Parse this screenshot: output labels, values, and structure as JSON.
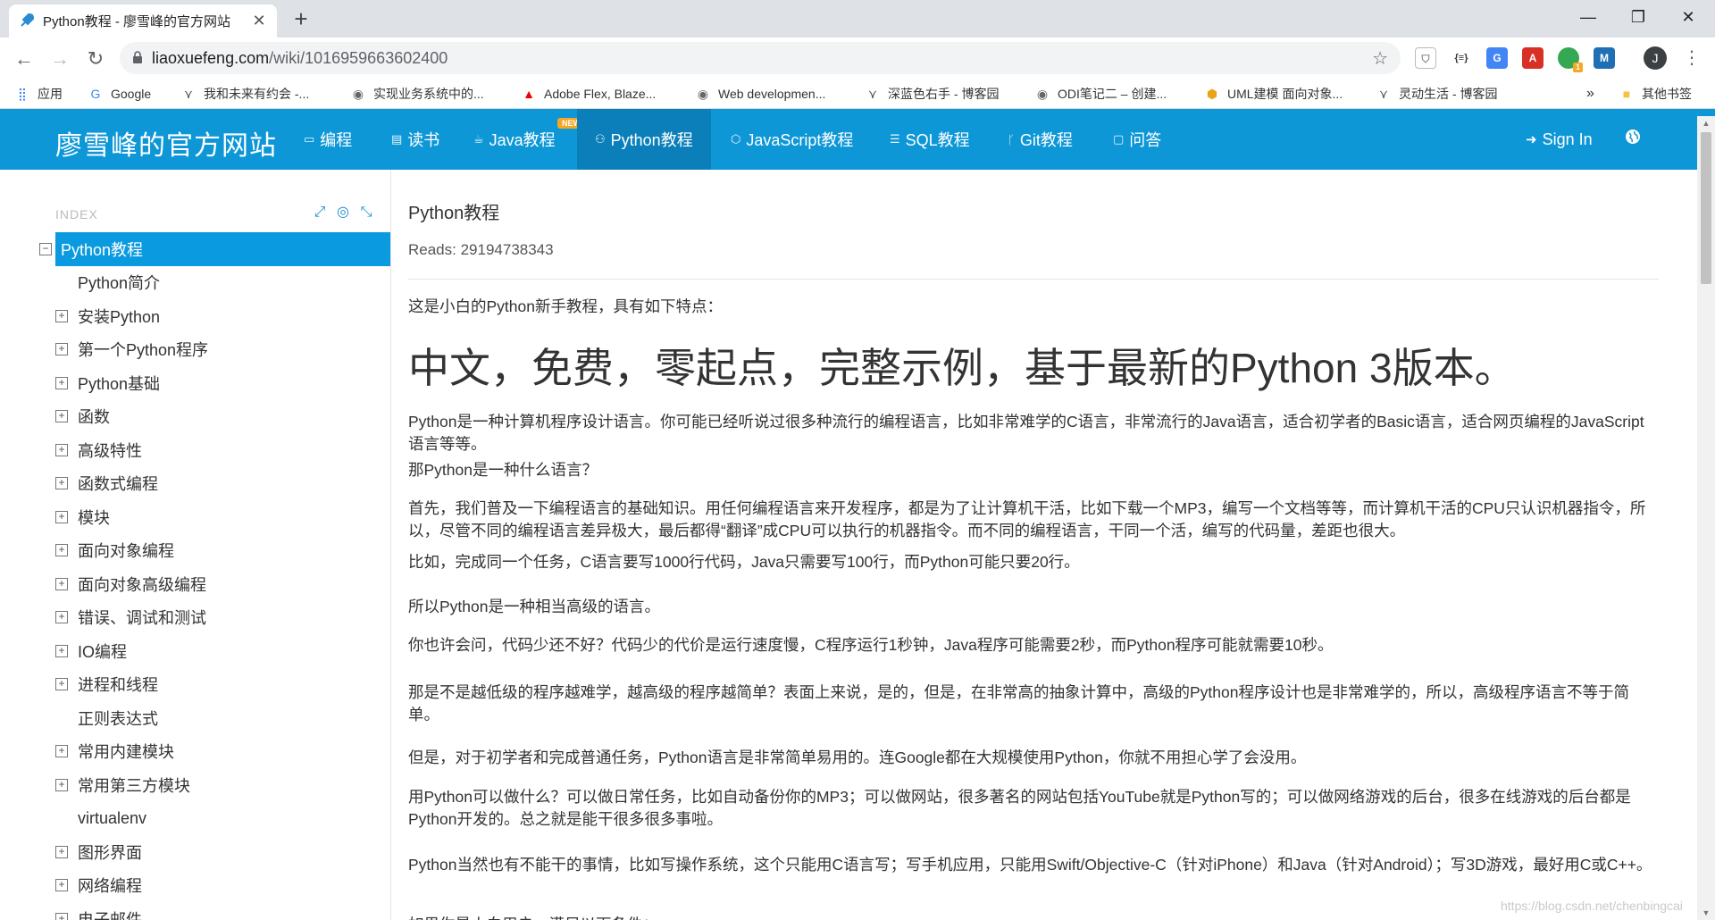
{
  "browser": {
    "tab_title": "Python教程 - 廖雪峰的官方网站",
    "url_host": "liaoxuefeng.com",
    "url_path": "/wiki/1016959663602400",
    "avatar_letter": "J",
    "bookmarks": [
      {
        "label": "应用",
        "icon": "apps-grid-icon"
      },
      {
        "label": "Google",
        "icon": "google-g-icon"
      },
      {
        "label": "我和未来有约会 -...",
        "icon": "cnblogs-icon"
      },
      {
        "label": "实现业务系统中的...",
        "icon": "globe-icon"
      },
      {
        "label": "Adobe Flex, Blaze...",
        "icon": "adobe-icon"
      },
      {
        "label": "Web developmen...",
        "icon": "globe-icon"
      },
      {
        "label": "深蓝色右手 - 博客园",
        "icon": "cnblogs-icon"
      },
      {
        "label": "ODI笔记二 – 创建...",
        "icon": "globe-icon"
      },
      {
        "label": "UML建模 面向对象...",
        "icon": "box-icon"
      },
      {
        "label": "灵动生活 - 博客园",
        "icon": "cnblogs-icon"
      }
    ],
    "bookmarks_overflow": "»",
    "other_bookmarks": "其他书签",
    "ext_badge_count": "1"
  },
  "site": {
    "brand": "廖雪峰的官方网站",
    "nav": [
      {
        "label": "编程",
        "icon": "terminal-icon"
      },
      {
        "label": "读书",
        "icon": "book-icon"
      },
      {
        "label": "Java教程",
        "icon": "coffee-icon"
      },
      {
        "label": "Python教程",
        "icon": "python-icon"
      },
      {
        "label": "JavaScript教程",
        "icon": "html5-icon"
      },
      {
        "label": "SQL教程",
        "icon": "database-icon"
      },
      {
        "label": "Git教程",
        "icon": "git-branch-icon"
      },
      {
        "label": "问答",
        "icon": "chat-icon"
      }
    ],
    "new_badge": "NEW",
    "signin": "Sign In"
  },
  "sidebar": {
    "index_label": "INDEX",
    "items": [
      {
        "label": "Python教程",
        "toggle": "minus",
        "selected": true
      },
      {
        "label": "Python简介",
        "toggle": "none"
      },
      {
        "label": "安装Python",
        "toggle": "plus"
      },
      {
        "label": "第一个Python程序",
        "toggle": "plus"
      },
      {
        "label": "Python基础",
        "toggle": "plus"
      },
      {
        "label": "函数",
        "toggle": "plus"
      },
      {
        "label": "高级特性",
        "toggle": "plus"
      },
      {
        "label": "函数式编程",
        "toggle": "plus"
      },
      {
        "label": "模块",
        "toggle": "plus"
      },
      {
        "label": "面向对象编程",
        "toggle": "plus"
      },
      {
        "label": "面向对象高级编程",
        "toggle": "plus"
      },
      {
        "label": "错误、调试和测试",
        "toggle": "plus"
      },
      {
        "label": "IO编程",
        "toggle": "plus"
      },
      {
        "label": "进程和线程",
        "toggle": "plus"
      },
      {
        "label": "正则表达式",
        "toggle": "none"
      },
      {
        "label": "常用内建模块",
        "toggle": "plus"
      },
      {
        "label": "常用第三方模块",
        "toggle": "plus"
      },
      {
        "label": "virtualenv",
        "toggle": "none"
      },
      {
        "label": "图形界面",
        "toggle": "plus"
      },
      {
        "label": "网络编程",
        "toggle": "plus"
      },
      {
        "label": "电子邮件",
        "toggle": "plus"
      }
    ]
  },
  "content": {
    "title": "Python教程",
    "reads": "Reads: 29194738343",
    "intro": "这是小白的Python新手教程，具有如下特点：",
    "headline": "中文，免费，零起点，完整示例，基于最新的Python 3版本。",
    "paragraphs": [
      "Python是一种计算机程序设计语言。你可能已经听说过很多种流行的编程语言，比如非常难学的C语言，非常流行的Java语言，适合初学者的Basic语言，适合网页编程的JavaScript语言等等。",
      "那Python是一种什么语言？",
      "首先，我们普及一下编程语言的基础知识。用任何编程语言来开发程序，都是为了让计算机干活，比如下载一个MP3，编写一个文档等等，而计算机干活的CPU只认识机器指令，所以，尽管不同的编程语言差异极大，最后都得“翻译”成CPU可以执行的机器指令。而不同的编程语言，干同一个活，编写的代码量，差距也很大。",
      "比如，完成同一个任务，C语言要写1000行代码，Java只需要写100行，而Python可能只要20行。",
      "所以Python是一种相当高级的语言。",
      "你也许会问，代码少还不好？代码少的代价是运行速度慢，C程序运行1秒钟，Java程序可能需要2秒，而Python程序可能就需要10秒。",
      "那是不是越低级的程序越难学，越高级的程序越简单？表面上来说，是的，但是，在非常高的抽象计算中，高级的Python程序设计也是非常难学的，所以，高级程序语言不等于简单。",
      "但是，对于初学者和完成普通任务，Python语言是非常简单易用的。连Google都在大规模使用Python，你就不用担心学了会没用。",
      "用Python可以做什么？可以做日常任务，比如自动备份你的MP3；可以做网站，很多著名的网站包括YouTube就是Python写的；可以做网络游戏的后台，很多在线游戏的后台都是Python开发的。总之就是能干很多很多事啦。",
      "Python当然也有不能干的事情，比如写操作系统，这个只能用C语言写；写手机应用，只能用Swift/Objective-C（针对iPhone）和Java（针对Android）；写3D游戏，最好用C或C++。",
      "如果你是小白用户，满足以下条件："
    ]
  },
  "watermark": "https://blog.csdn.net/chenbingcai",
  "colors": {
    "navbar": "#0e97d7",
    "navbar_active": "#0a7fba",
    "sidebar_selected": "#0a9ae0",
    "index_tools": "#1a8bd4"
  }
}
